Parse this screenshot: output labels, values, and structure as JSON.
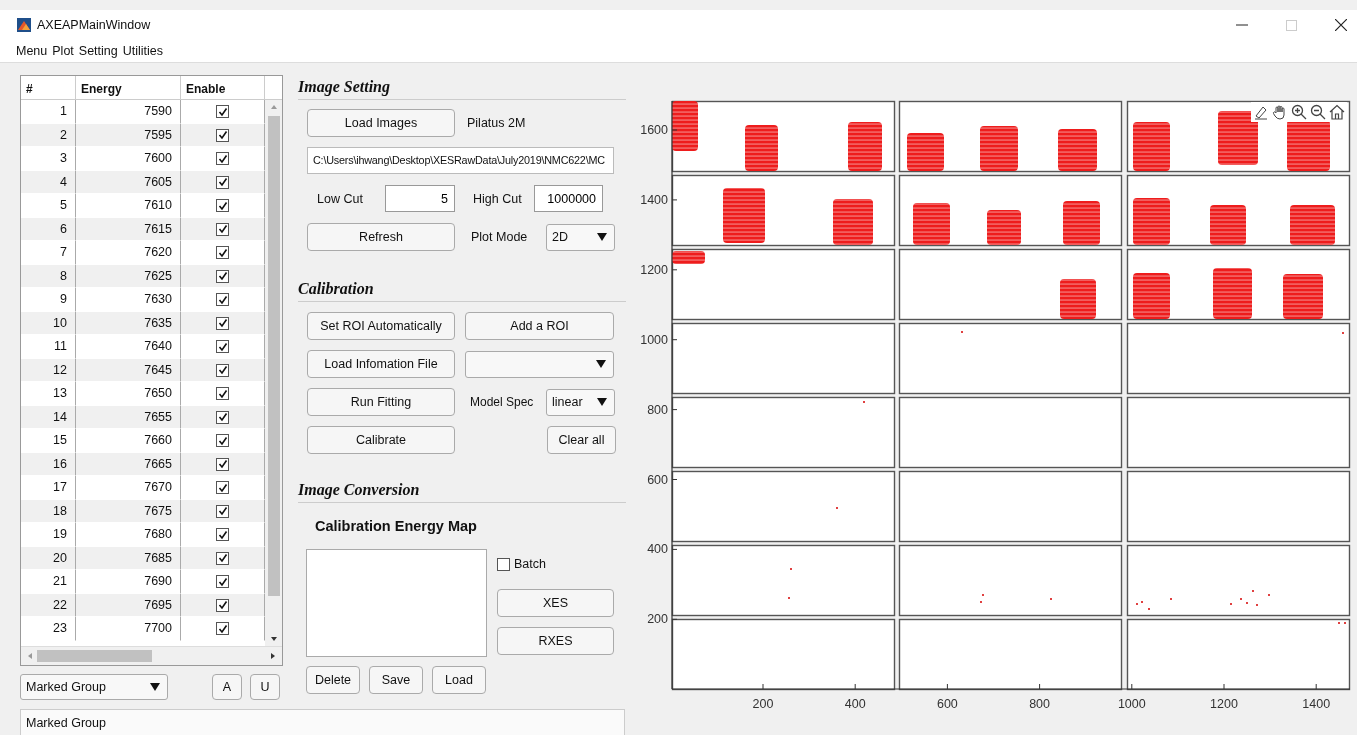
{
  "window": {
    "title": "AXEAPMainWindow"
  },
  "menu": [
    "Menu",
    "Plot",
    "Setting",
    "Utilities"
  ],
  "table": {
    "columns": [
      "#",
      "Energy",
      "Enable"
    ],
    "rows": [
      {
        "index": "1",
        "energy": "7590",
        "enabled": true
      },
      {
        "index": "2",
        "energy": "7595",
        "enabled": true
      },
      {
        "index": "3",
        "energy": "7600",
        "enabled": true
      },
      {
        "index": "4",
        "energy": "7605",
        "enabled": true
      },
      {
        "index": "5",
        "energy": "7610",
        "enabled": true
      },
      {
        "index": "6",
        "energy": "7615",
        "enabled": true
      },
      {
        "index": "7",
        "energy": "7620",
        "enabled": true
      },
      {
        "index": "8",
        "energy": "7625",
        "enabled": true
      },
      {
        "index": "9",
        "energy": "7630",
        "enabled": true
      },
      {
        "index": "10",
        "energy": "7635",
        "enabled": true
      },
      {
        "index": "11",
        "energy": "7640",
        "enabled": true
      },
      {
        "index": "12",
        "energy": "7645",
        "enabled": true
      },
      {
        "index": "13",
        "energy": "7650",
        "enabled": true
      },
      {
        "index": "14",
        "energy": "7655",
        "enabled": true
      },
      {
        "index": "15",
        "energy": "7660",
        "enabled": true
      },
      {
        "index": "16",
        "energy": "7665",
        "enabled": true
      },
      {
        "index": "17",
        "energy": "7670",
        "enabled": true
      },
      {
        "index": "18",
        "energy": "7675",
        "enabled": true
      },
      {
        "index": "19",
        "energy": "7680",
        "enabled": true
      },
      {
        "index": "20",
        "energy": "7685",
        "enabled": true
      },
      {
        "index": "21",
        "energy": "7690",
        "enabled": true
      },
      {
        "index": "22",
        "energy": "7695",
        "enabled": true
      },
      {
        "index": "23",
        "energy": "7700",
        "enabled": true
      }
    ]
  },
  "group_select": {
    "value": "Marked Group"
  },
  "group_buttons": [
    "A",
    "U"
  ],
  "status_bar": "Marked Group",
  "image_setting": {
    "title": "Image Setting",
    "load_button": "Load Images",
    "detector": "Pilatus 2M",
    "path": "C:\\Users\\ihwang\\Desktop\\XESRawData\\July2019\\NMC622\\MC",
    "low_cut_label": "Low Cut",
    "low_cut": "5",
    "high_cut_label": "High Cut",
    "high_cut": "1000000",
    "refresh_button": "Refresh",
    "plot_mode_label": "Plot Mode",
    "plot_mode": "2D"
  },
  "calibration": {
    "title": "Calibration",
    "set_roi_button": "Set ROI Automatically",
    "add_roi_button": "Add a ROI",
    "load_info_button": "Load Infomation File",
    "run_fitting_button": "Run Fitting",
    "model_spec_label": "Model Spec",
    "model_spec": "linear",
    "calibrate_button": "Calibrate",
    "clear_button": "Clear all"
  },
  "image_conversion": {
    "title": "Image Conversion",
    "map_title": "Calibration Energy Map",
    "batch": {
      "label": "Batch",
      "checked": false
    },
    "xes_button": "XES",
    "rxes_button": "RXES",
    "buttons": [
      "Delete",
      "Save",
      "Load"
    ]
  },
  "plot": {
    "xticks": [
      "200",
      "400",
      "600",
      "800",
      "1000",
      "1200",
      "1400"
    ],
    "yticks": [
      "1600",
      "1400",
      "1200",
      "1000",
      "800",
      "600",
      "400",
      "200"
    ]
  }
}
